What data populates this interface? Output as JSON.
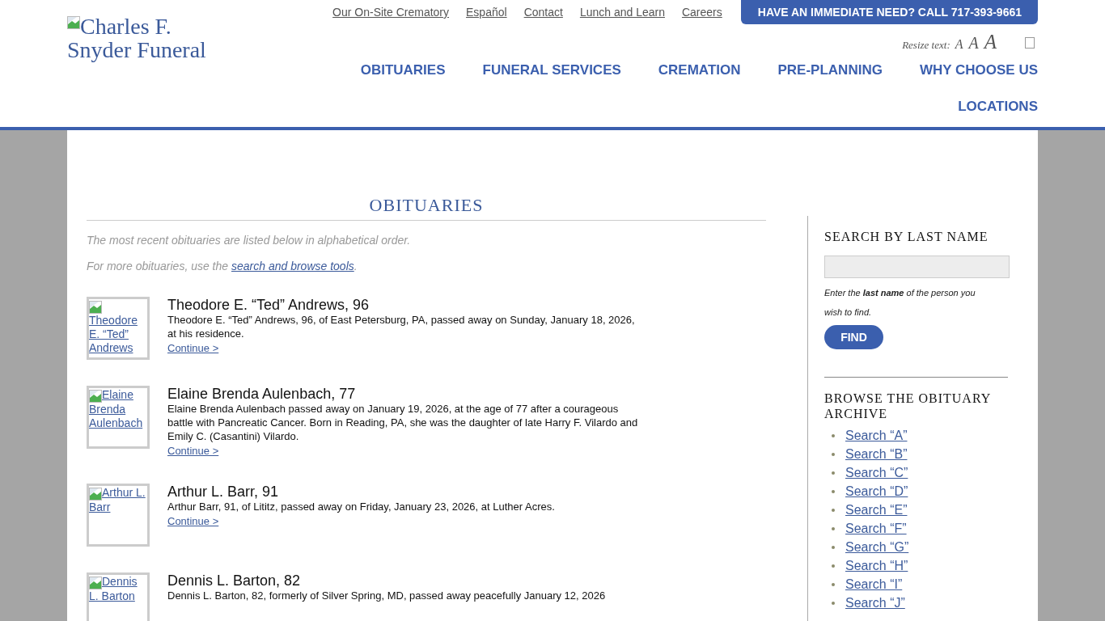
{
  "logo": {
    "alt_text": "Charles F. Snyder Funeral"
  },
  "utility_links": [
    "Our On-Site Crematory",
    "Español",
    "Contact",
    "Lunch and Learn",
    "Careers"
  ],
  "immediate_need_button": "HAVE AN IMMEDIATE NEED? CALL 717-393-9661",
  "resize_text": {
    "label": "Resize text:",
    "sizes": [
      "A",
      "A",
      "A"
    ]
  },
  "nav": [
    "OBITUARIES",
    "FUNERAL SERVICES",
    "CREMATION",
    "PRE-PLANNING",
    "WHY CHOOSE US",
    "LOCATIONS"
  ],
  "main": {
    "title": "OBITUARIES",
    "intro": "The most recent obituaries are listed below in alphabetical order.",
    "more_prefix": "For more obituaries, use the ",
    "more_link": "search and browse tools",
    "more_suffix": ".",
    "obituaries": [
      {
        "photo_alt": "Theodore E. “Ted” Andrews",
        "name": "Theodore E. “Ted” Andrews, 96",
        "summary": "Theodore E. “Ted” Andrews, 96, of East Petersburg, PA, passed away on Sunday, January 18, 2026, at his residence.",
        "link": "Continue >"
      },
      {
        "photo_alt": "Elaine Brenda Aulenbach",
        "name": "Elaine Brenda Aulenbach, 77",
        "summary": "Elaine Brenda Aulenbach passed away on January 19, 2026, at the age of 77 after a courageous battle with Pancreatic Cancer. Born in Reading, PA, she was the daughter of late Harry F. Vilardo and Emily C. (Casantini) Vilardo.",
        "link": "Continue >"
      },
      {
        "photo_alt": "Arthur L. Barr",
        "name": "Arthur L. Barr, 91",
        "summary": "Arthur Barr, 91, of Lititz, passed away on Friday, January 23, 2026, at Luther Acres.",
        "link": "Continue >"
      },
      {
        "photo_alt": "Dennis L. Barton",
        "name": "Dennis L. Barton, 82",
        "summary": "Dennis L. Barton, 82, formerly of Silver Spring, MD, passed away peacefully January 12, 2026"
      }
    ]
  },
  "sidebar": {
    "search_title": "SEARCH BY LAST NAME",
    "search_hint": "Enter the **last name** of the person you wish to find.",
    "find_button": "FIND",
    "browse_title": "BROWSE THE OBITUARY ARCHIVE",
    "browse_links": [
      "Search “A”",
      "Search “B”",
      "Search “C”",
      "Search “D”",
      "Search “E”",
      "Search “F”",
      "Search “G”",
      "Search “H”",
      "Search “I”",
      "Search “J”"
    ]
  }
}
